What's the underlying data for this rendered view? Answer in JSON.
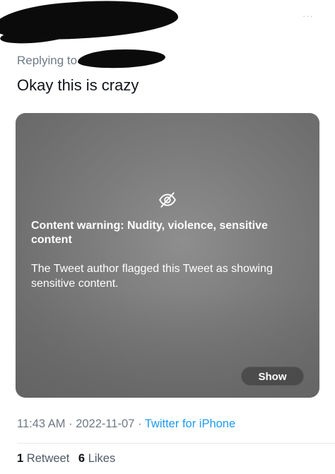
{
  "header": {
    "more_icon": "more-horizontal-icon",
    "more_glyph": "···"
  },
  "tweet": {
    "replying_to_label": "Replying to",
    "text": "Okay this is crazy"
  },
  "media": {
    "warning_icon": "eye-slash-icon",
    "warning_title": "Content warning: Nudity, violence, sensitive content",
    "warning_description": "The Tweet author flagged this Tweet as showing sensitive content.",
    "show_label": "Show"
  },
  "meta": {
    "time": "11:43 AM",
    "separator": "·",
    "date": "2022-11-07",
    "source": "Twitter for iPhone"
  },
  "stats": {
    "retweets_count": "1",
    "retweets_label": "Retweet",
    "likes_count": "6",
    "likes_label": "Likes"
  },
  "colors": {
    "link": "#1d9bf0",
    "secondary_text": "#6f7a86",
    "media_gray": "#7c7c7c"
  }
}
